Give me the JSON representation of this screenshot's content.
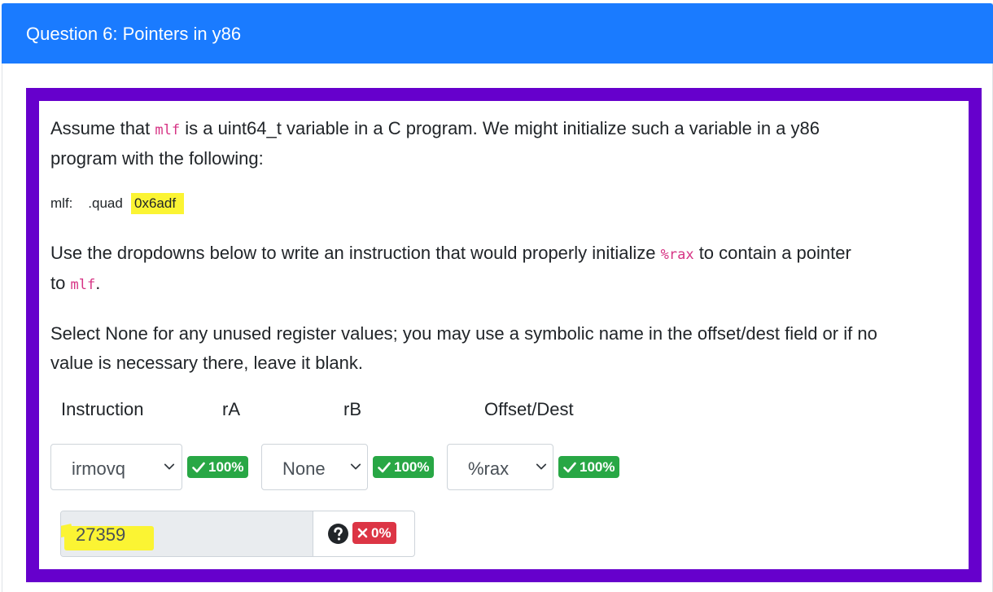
{
  "header": {
    "title": "Question 6: Pointers in y86"
  },
  "question": {
    "intro": {
      "p1_a": "Assume that ",
      "p1_code": "mlf",
      "p1_b": " is a uint64_t variable in a C program. We might initialize such a variable in a y86",
      "p1_line2": "program with the following:"
    },
    "code": {
      "label": "mlf:",
      "directive": ".quad",
      "value": "0x6adf"
    },
    "instructions": {
      "p2_a": "Use the dropdowns below to write an instruction that would properly initialize ",
      "p2_code": "%rax",
      "p2_b": " to contain a pointer",
      "p2_line2_a": "to ",
      "p2_line2_code": "mlf",
      "p2_line2_b": ".",
      "p3_line1": "Select None for any unused register values; you may use a symbolic name in the offset/dest field or if no",
      "p3_line2": "value is necessary there, leave it blank."
    }
  },
  "columns": {
    "instruction": "Instruction",
    "ra": "rA",
    "rb": "rB",
    "offset": "Offset/Dest"
  },
  "answers": {
    "instruction": {
      "selected": "irmovq",
      "score": "100%"
    },
    "ra": {
      "selected": "None",
      "score": "100%"
    },
    "rb": {
      "selected": "%rax",
      "score": "100%"
    },
    "offset": {
      "value": "27359",
      "score": "0%"
    }
  },
  "colors": {
    "header_bg": "#1a7bff",
    "frame": "#6600cc",
    "success": "#28a745",
    "danger": "#dc3545",
    "highlight": "#fbf433",
    "code_pink": "#d63384"
  },
  "icons": {
    "check": "check-icon",
    "cross": "x-icon",
    "help": "question-circle-icon",
    "chevron": "chevron-down-icon"
  }
}
